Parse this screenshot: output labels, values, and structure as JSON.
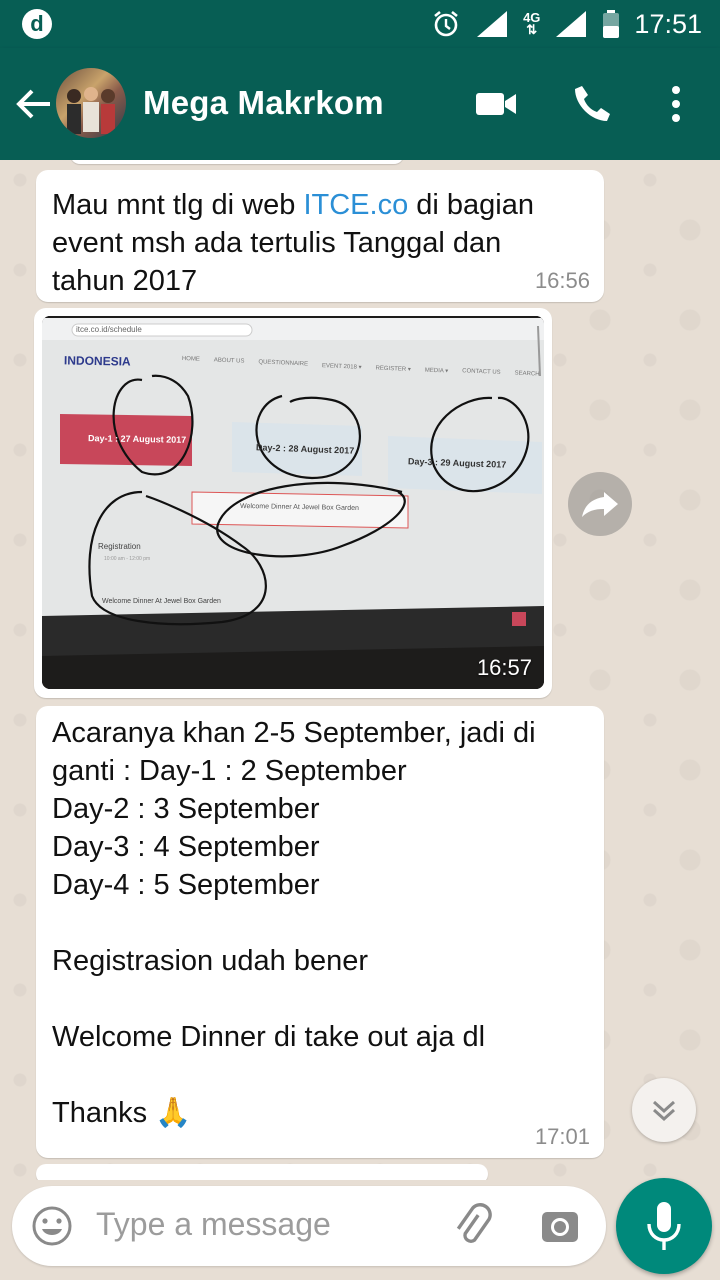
{
  "status_bar": {
    "app_badge": "d",
    "network": "4G",
    "time": "17:51"
  },
  "header": {
    "contact_name": "Mega Makrkom"
  },
  "messages": {
    "m1": {
      "text_before": "Mau mnt tlg di web ",
      "link": "ITCE.co",
      "text_after": " di bagian\nevent msh ada tertulis Tanggal dan\ntahun 2017",
      "time": "16:56"
    },
    "m2": {
      "time": "16:57",
      "photo": {
        "url_bar": "itce.co.id/schedule",
        "logo": "INDONESIA",
        "nav": [
          "HOME",
          "ABOUT US",
          "QUESTIONNAIRE",
          "EVENT 2018 ▾",
          "REGISTER ▾",
          "MEDIA ▾",
          "CONTACT US",
          "SEARCH"
        ],
        "day1": "Day-1 : 27 August 2017",
        "day2": "Day-2 : 28 August 2017",
        "day3": "Day-3 : 29 August 2017",
        "welcome_btn": "Welcome Dinner At Jewel Box Garden",
        "registration": "Registration",
        "reg_time": "10:00 am - 12:00 pm",
        "welcome_item": "Welcome Dinner At Jewel Box Garden"
      }
    },
    "m3": {
      "text": "Acaranya khan 2-5 September, jadi di\nganti : Day-1 : 2 September\nDay-2 : 3 September\nDay-3 : 4 September\nDay-4 : 5 September\n\nRegistrasion udah bener\n\nWelcome Dinner di take out aja dl\n\nThanks 🙏",
      "time": "17:01"
    }
  },
  "composer": {
    "placeholder": "Type a message"
  },
  "icons": [
    "back-arrow-icon",
    "video-call-icon",
    "phone-icon",
    "more-vert-icon",
    "forward-icon",
    "chevron-down-icon",
    "emoji-icon",
    "attach-icon",
    "camera-icon",
    "mic-icon",
    "alarm-icon",
    "signal-icon",
    "battery-icon"
  ],
  "colors": {
    "header": "#075e54",
    "link": "#2b8fd6",
    "mic": "#00897b",
    "chat_bg": "#e7ded4"
  }
}
